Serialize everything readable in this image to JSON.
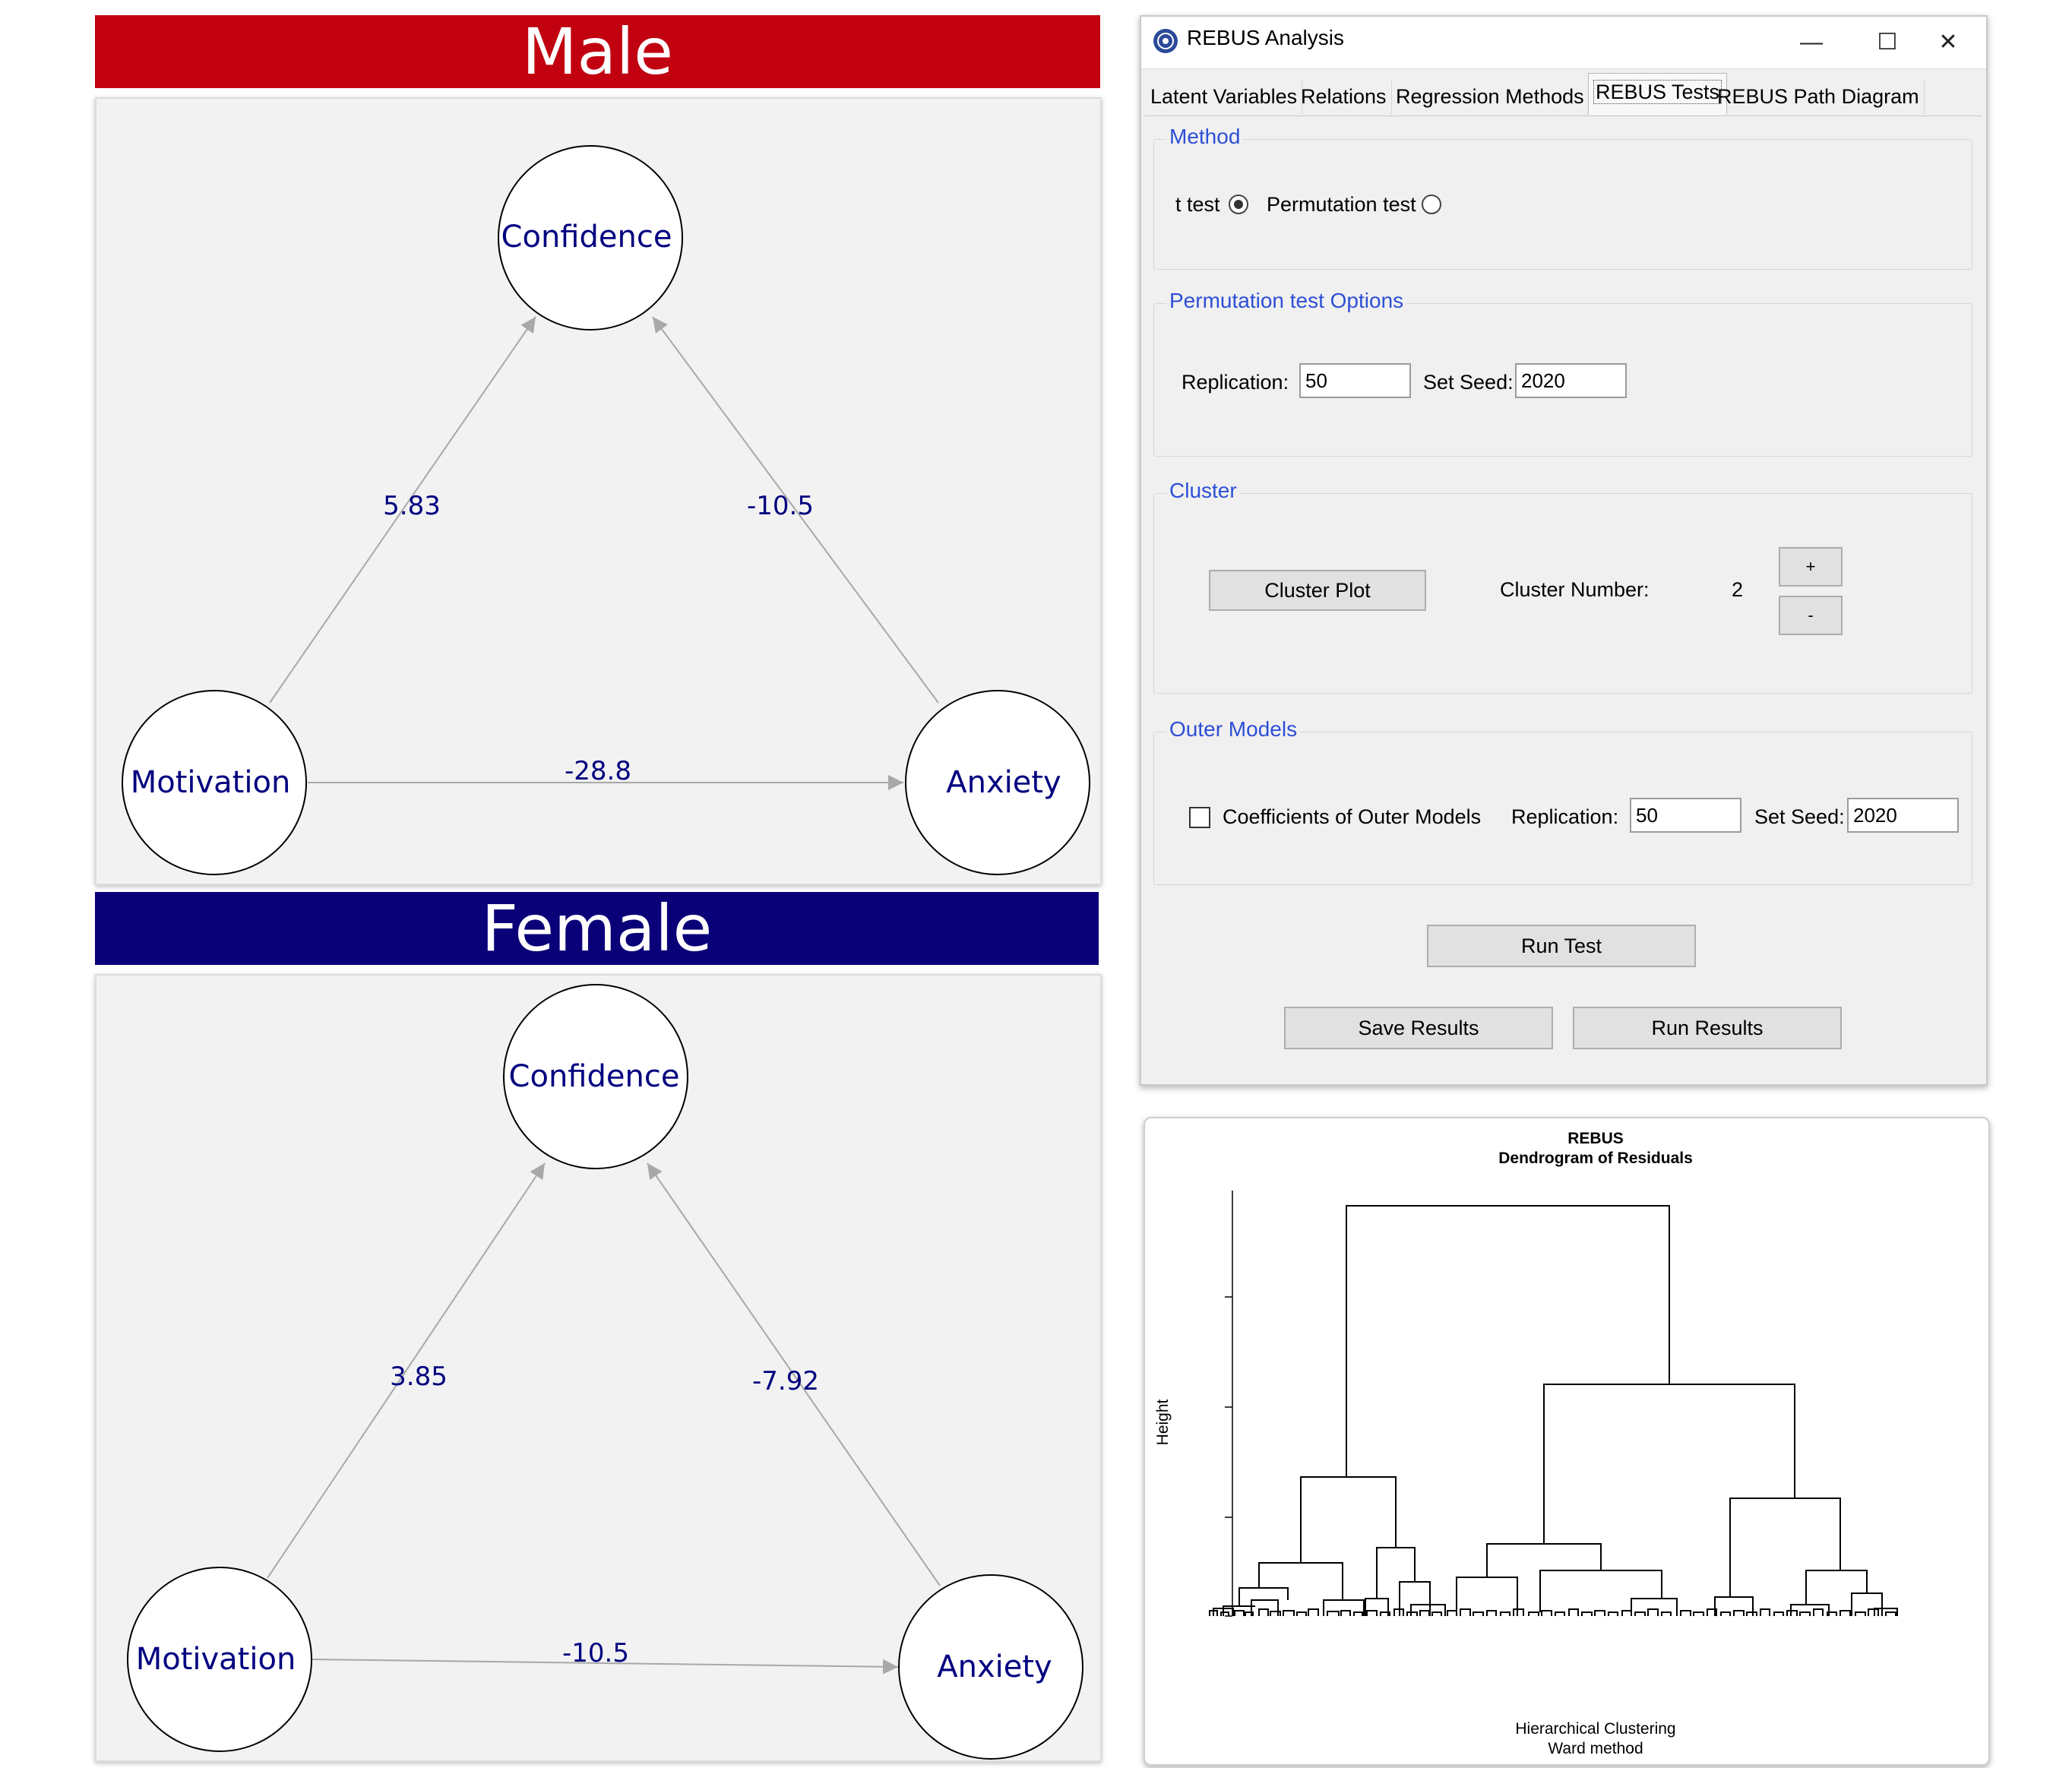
{
  "male_section": {
    "banner": {
      "title": "Male",
      "color": "#c10010"
    },
    "nodes": {
      "top": "Confidence",
      "left": "Motivation",
      "right": "Anxiety"
    },
    "edges": {
      "motivation_to_confidence": "5.83",
      "anxiety_to_confidence": "-10.5",
      "motivation_to_anxiety": "-28.8"
    }
  },
  "female_section": {
    "banner": {
      "title": "Female",
      "color": "#0a0078"
    },
    "nodes": {
      "top": "Confidence",
      "left": "Motivation",
      "right": "Anxiety"
    },
    "edges": {
      "motivation_to_confidence": "3.85",
      "anxiety_to_confidence": "-7.92",
      "motivation_to_anxiety": "-10.5"
    }
  },
  "window": {
    "title": "REBUS Analysis",
    "controls": {
      "minimize": "—",
      "maximize": "☐",
      "close": "✕"
    },
    "tabs": [
      "Latent Variables",
      "Relations",
      "Regression Methods",
      "REBUS Tests",
      "REBUS Path Diagram"
    ],
    "active_tab": "REBUS Tests",
    "method": {
      "title": "Method",
      "t_test_label": "t test",
      "t_test_selected": true,
      "permutation_label": "Permutation test",
      "permutation_selected": false
    },
    "permutation_options": {
      "title": "Permutation test Options",
      "replication_label": "Replication:",
      "replication_value": "50",
      "seed_label": "Set Seed:",
      "seed_value": "2020"
    },
    "cluster": {
      "title": "Cluster",
      "plot_button": "Cluster Plot",
      "number_label": "Cluster Number:",
      "number_value": "2",
      "plus_label": "+",
      "minus_label": "-"
    },
    "outer_models": {
      "title": "Outer Models",
      "checkbox_label": "Coefficients of Outer Models",
      "checked": false,
      "replication_label": "Replication:",
      "replication_value": "50",
      "seed_label": "Set Seed:",
      "seed_value": "2020"
    },
    "buttons": {
      "run_test": "Run Test",
      "save_results": "Save Results",
      "run_results": "Run Results"
    }
  },
  "dendrogram": {
    "title": "REBUS",
    "subtitle": "Dendrogram of Residuals",
    "ylabel": "Height",
    "xlabel_line1": "Hierarchical Clustering",
    "xlabel_line2": "Ward method"
  },
  "colors": {
    "node_text": "#000080",
    "edge_line": "#a8a8a8",
    "group_title": "#2d4fd6"
  }
}
